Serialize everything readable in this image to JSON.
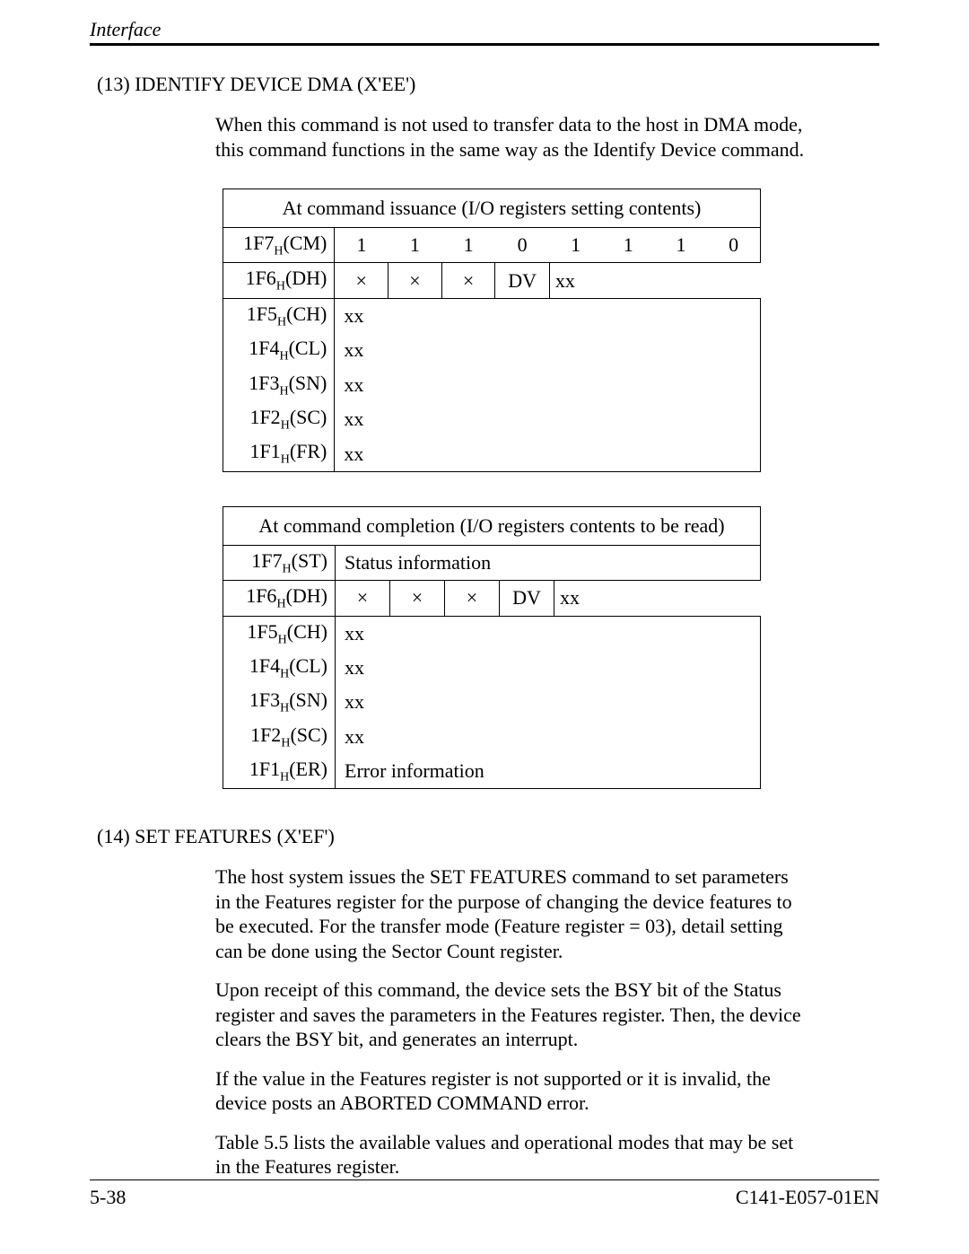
{
  "header": {
    "running": "Interface"
  },
  "sections": {
    "s13": {
      "heading": "(13)  IDENTIFY DEVICE DMA (X'EE')",
      "para1": "When this command is not used to transfer data to the host in DMA mode, this command functions in the same way as the Identify Device command."
    },
    "s14": {
      "heading": "(14)  SET FEATURES (X'EF')",
      "para1": "The host system issues the SET FEATURES command to set parameters in the Features register for the purpose of changing the device features to be executed. For the transfer mode (Feature register = 03), detail setting can be done using the Sector Count register.",
      "para2": "Upon receipt of this command, the device sets the BSY bit of the Status register and saves the parameters in the Features register.  Then, the device clears the BSY bit, and generates an interrupt.",
      "para3": "If the value in the Features register is not supported or it is invalid, the device posts an ABORTED COMMAND error.",
      "para4": "Table 5.5 lists the available values and operational modes that may be set in the Features register."
    }
  },
  "table_issue": {
    "title": "At command issuance (I/O registers setting contents)",
    "rows": {
      "cm": {
        "label_reg": "1F7",
        "label_suf": "(CM)",
        "bits": [
          "1",
          "1",
          "1",
          "0",
          "1",
          "1",
          "1",
          "0"
        ]
      },
      "dh": {
        "label_reg": "1F6",
        "label_suf": "(DH)",
        "c0": "×",
        "c1": "×",
        "c2": "×",
        "c3": "DV",
        "c4": "xx"
      },
      "ch": {
        "label_reg": "1F5",
        "label_suf": "(CH)",
        "val": "xx"
      },
      "cl": {
        "label_reg": "1F4",
        "label_suf": "(CL)",
        "val": "xx"
      },
      "sn": {
        "label_reg": "1F3",
        "label_suf": "(SN)",
        "val": "xx"
      },
      "sc": {
        "label_reg": "1F2",
        "label_suf": "(SC)",
        "val": "xx"
      },
      "fr": {
        "label_reg": "1F1",
        "label_suf": "(FR)",
        "val": "xx"
      }
    }
  },
  "table_complete": {
    "title": "At command completion (I/O registers contents to be read)",
    "rows": {
      "st": {
        "label_reg": "1F7",
        "label_suf": "(ST)",
        "val": "Status information"
      },
      "dh": {
        "label_reg": "1F6",
        "label_suf": "(DH)",
        "c0": "×",
        "c1": "×",
        "c2": "×",
        "c3": "DV",
        "c4": "xx"
      },
      "ch": {
        "label_reg": "1F5",
        "label_suf": "(CH)",
        "val": "xx"
      },
      "cl": {
        "label_reg": "1F4",
        "label_suf": "(CL)",
        "val": "xx"
      },
      "sn": {
        "label_reg": "1F3",
        "label_suf": "(SN)",
        "val": "xx"
      },
      "sc": {
        "label_reg": "1F2",
        "label_suf": "(SC)",
        "val": "xx"
      },
      "er": {
        "label_reg": "1F1",
        "label_suf": "(ER)",
        "val": "Error information"
      }
    }
  },
  "footer": {
    "page": "5-38",
    "doc": "C141-E057-01EN"
  },
  "glyphs": {
    "sub_h": "H"
  }
}
